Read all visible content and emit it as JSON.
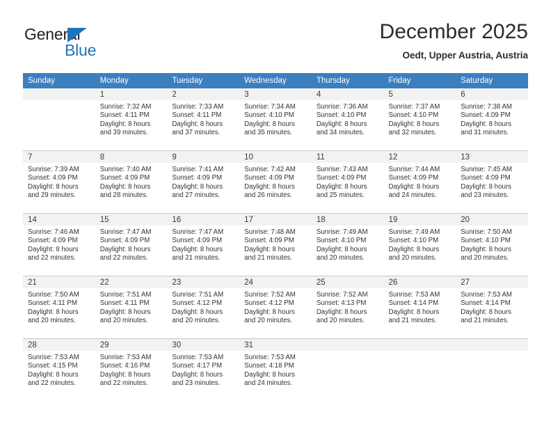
{
  "brand": {
    "name_top": "General",
    "name_bottom": "Blue",
    "triangle_color": "#1b75bc"
  },
  "header": {
    "title": "December 2025",
    "location": "Oedt, Upper Austria, Austria"
  },
  "theme": {
    "header_blue": "#3b7fbe",
    "daynum_bg": "#f2f2f2",
    "grid_line": "#c8c8c8"
  },
  "weekdays": [
    "Sunday",
    "Monday",
    "Tuesday",
    "Wednesday",
    "Thursday",
    "Friday",
    "Saturday"
  ],
  "weeks": [
    [
      {
        "day": "",
        "lines": []
      },
      {
        "day": "1",
        "lines": [
          "Sunrise: 7:32 AM",
          "Sunset: 4:11 PM",
          "Daylight: 8 hours",
          "and 39 minutes."
        ]
      },
      {
        "day": "2",
        "lines": [
          "Sunrise: 7:33 AM",
          "Sunset: 4:11 PM",
          "Daylight: 8 hours",
          "and 37 minutes."
        ]
      },
      {
        "day": "3",
        "lines": [
          "Sunrise: 7:34 AM",
          "Sunset: 4:10 PM",
          "Daylight: 8 hours",
          "and 35 minutes."
        ]
      },
      {
        "day": "4",
        "lines": [
          "Sunrise: 7:36 AM",
          "Sunset: 4:10 PM",
          "Daylight: 8 hours",
          "and 34 minutes."
        ]
      },
      {
        "day": "5",
        "lines": [
          "Sunrise: 7:37 AM",
          "Sunset: 4:10 PM",
          "Daylight: 8 hours",
          "and 32 minutes."
        ]
      },
      {
        "day": "6",
        "lines": [
          "Sunrise: 7:38 AM",
          "Sunset: 4:09 PM",
          "Daylight: 8 hours",
          "and 31 minutes."
        ]
      }
    ],
    [
      {
        "day": "7",
        "lines": [
          "Sunrise: 7:39 AM",
          "Sunset: 4:09 PM",
          "Daylight: 8 hours",
          "and 29 minutes."
        ]
      },
      {
        "day": "8",
        "lines": [
          "Sunrise: 7:40 AM",
          "Sunset: 4:09 PM",
          "Daylight: 8 hours",
          "and 28 minutes."
        ]
      },
      {
        "day": "9",
        "lines": [
          "Sunrise: 7:41 AM",
          "Sunset: 4:09 PM",
          "Daylight: 8 hours",
          "and 27 minutes."
        ]
      },
      {
        "day": "10",
        "lines": [
          "Sunrise: 7:42 AM",
          "Sunset: 4:09 PM",
          "Daylight: 8 hours",
          "and 26 minutes."
        ]
      },
      {
        "day": "11",
        "lines": [
          "Sunrise: 7:43 AM",
          "Sunset: 4:09 PM",
          "Daylight: 8 hours",
          "and 25 minutes."
        ]
      },
      {
        "day": "12",
        "lines": [
          "Sunrise: 7:44 AM",
          "Sunset: 4:09 PM",
          "Daylight: 8 hours",
          "and 24 minutes."
        ]
      },
      {
        "day": "13",
        "lines": [
          "Sunrise: 7:45 AM",
          "Sunset: 4:09 PM",
          "Daylight: 8 hours",
          "and 23 minutes."
        ]
      }
    ],
    [
      {
        "day": "14",
        "lines": [
          "Sunrise: 7:46 AM",
          "Sunset: 4:09 PM",
          "Daylight: 8 hours",
          "and 22 minutes."
        ]
      },
      {
        "day": "15",
        "lines": [
          "Sunrise: 7:47 AM",
          "Sunset: 4:09 PM",
          "Daylight: 8 hours",
          "and 22 minutes."
        ]
      },
      {
        "day": "16",
        "lines": [
          "Sunrise: 7:47 AM",
          "Sunset: 4:09 PM",
          "Daylight: 8 hours",
          "and 21 minutes."
        ]
      },
      {
        "day": "17",
        "lines": [
          "Sunrise: 7:48 AM",
          "Sunset: 4:09 PM",
          "Daylight: 8 hours",
          "and 21 minutes."
        ]
      },
      {
        "day": "18",
        "lines": [
          "Sunrise: 7:49 AM",
          "Sunset: 4:10 PM",
          "Daylight: 8 hours",
          "and 20 minutes."
        ]
      },
      {
        "day": "19",
        "lines": [
          "Sunrise: 7:49 AM",
          "Sunset: 4:10 PM",
          "Daylight: 8 hours",
          "and 20 minutes."
        ]
      },
      {
        "day": "20",
        "lines": [
          "Sunrise: 7:50 AM",
          "Sunset: 4:10 PM",
          "Daylight: 8 hours",
          "and 20 minutes."
        ]
      }
    ],
    [
      {
        "day": "21",
        "lines": [
          "Sunrise: 7:50 AM",
          "Sunset: 4:11 PM",
          "Daylight: 8 hours",
          "and 20 minutes."
        ]
      },
      {
        "day": "22",
        "lines": [
          "Sunrise: 7:51 AM",
          "Sunset: 4:11 PM",
          "Daylight: 8 hours",
          "and 20 minutes."
        ]
      },
      {
        "day": "23",
        "lines": [
          "Sunrise: 7:51 AM",
          "Sunset: 4:12 PM",
          "Daylight: 8 hours",
          "and 20 minutes."
        ]
      },
      {
        "day": "24",
        "lines": [
          "Sunrise: 7:52 AM",
          "Sunset: 4:12 PM",
          "Daylight: 8 hours",
          "and 20 minutes."
        ]
      },
      {
        "day": "25",
        "lines": [
          "Sunrise: 7:52 AM",
          "Sunset: 4:13 PM",
          "Daylight: 8 hours",
          "and 20 minutes."
        ]
      },
      {
        "day": "26",
        "lines": [
          "Sunrise: 7:53 AM",
          "Sunset: 4:14 PM",
          "Daylight: 8 hours",
          "and 21 minutes."
        ]
      },
      {
        "day": "27",
        "lines": [
          "Sunrise: 7:53 AM",
          "Sunset: 4:14 PM",
          "Daylight: 8 hours",
          "and 21 minutes."
        ]
      }
    ],
    [
      {
        "day": "28",
        "lines": [
          "Sunrise: 7:53 AM",
          "Sunset: 4:15 PM",
          "Daylight: 8 hours",
          "and 22 minutes."
        ]
      },
      {
        "day": "29",
        "lines": [
          "Sunrise: 7:53 AM",
          "Sunset: 4:16 PM",
          "Daylight: 8 hours",
          "and 22 minutes."
        ]
      },
      {
        "day": "30",
        "lines": [
          "Sunrise: 7:53 AM",
          "Sunset: 4:17 PM",
          "Daylight: 8 hours",
          "and 23 minutes."
        ]
      },
      {
        "day": "31",
        "lines": [
          "Sunrise: 7:53 AM",
          "Sunset: 4:18 PM",
          "Daylight: 8 hours",
          "and 24 minutes."
        ]
      },
      {
        "day": "",
        "lines": []
      },
      {
        "day": "",
        "lines": []
      },
      {
        "day": "",
        "lines": []
      }
    ]
  ]
}
